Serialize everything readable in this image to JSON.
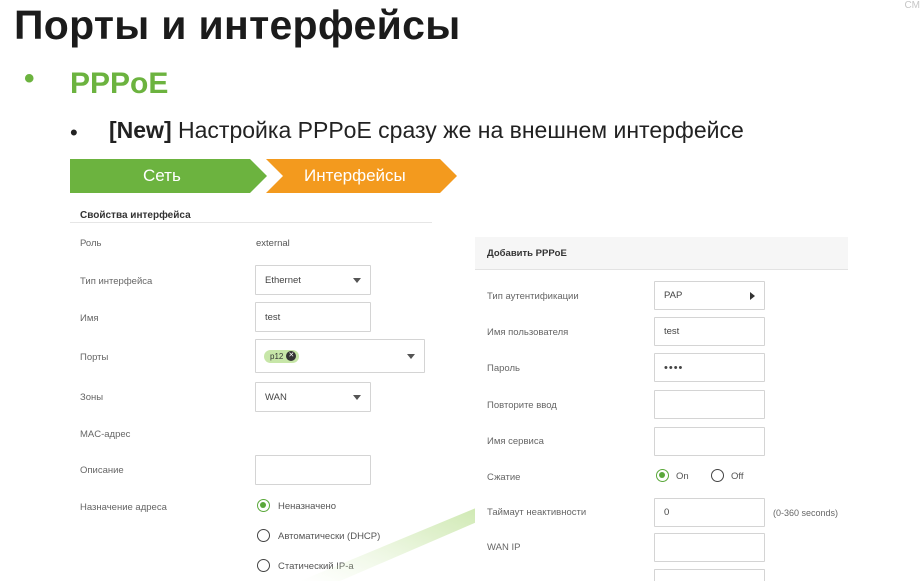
{
  "slide": {
    "title": "Порты и интерфейсы",
    "watermark": "СМ",
    "bullet_symbol": "•",
    "heading": "PPPoE",
    "sub_bullet_symbol": "•",
    "sub_tag": "[New]",
    "sub_text": " Настройка PPPoE сразу же на внешнем интерфейсе"
  },
  "breadcrumb": {
    "items": [
      {
        "label": "Сеть",
        "color": "#6cb33f"
      },
      {
        "label": "Интерфейсы",
        "color": "#f39a1e"
      }
    ]
  },
  "interface_panel": {
    "title": "Свойства интерфейса",
    "role_label": "Роль",
    "role_value": "external",
    "type_label": "Тип интерфейса",
    "type_value": "Ethernet",
    "name_label": "Имя",
    "name_value": "test",
    "ports_label": "Порты",
    "ports_chip": "p12",
    "zones_label": "Зоны",
    "zones_value": "WAN",
    "mac_label": "MAC-адрес",
    "description_label": "Описание",
    "description_value": "",
    "addr_label": "Назначение адреса",
    "addr_options": [
      {
        "label": "Неназначено",
        "checked": true
      },
      {
        "label": "Автоматически (DHCP)",
        "checked": false
      },
      {
        "label": "Статический IP-а",
        "checked": false
      }
    ]
  },
  "pppoe_panel": {
    "title": "Добавить PPPoE",
    "auth_label": "Тип аутентификации",
    "auth_value": "PAP",
    "user_label": "Имя пользователя",
    "user_value": "test",
    "pass_label": "Пароль",
    "pass_value": "••••",
    "repeat_label": "Повторите ввод",
    "repeat_value": "",
    "service_label": "Имя сервиса",
    "service_value": "",
    "compress_label": "Сжатие",
    "compress_on": "On",
    "compress_off": "Off",
    "compress_selected": "On",
    "timeout_label": "Таймаут неактивности",
    "timeout_value": "0",
    "timeout_hint": "(0-360 seconds)",
    "wanip_label": "WAN IP",
    "wanip_value": ""
  },
  "colors": {
    "accent_green": "#6cb33f",
    "accent_orange": "#f39a1e",
    "radio_green": "#5aa83a"
  }
}
